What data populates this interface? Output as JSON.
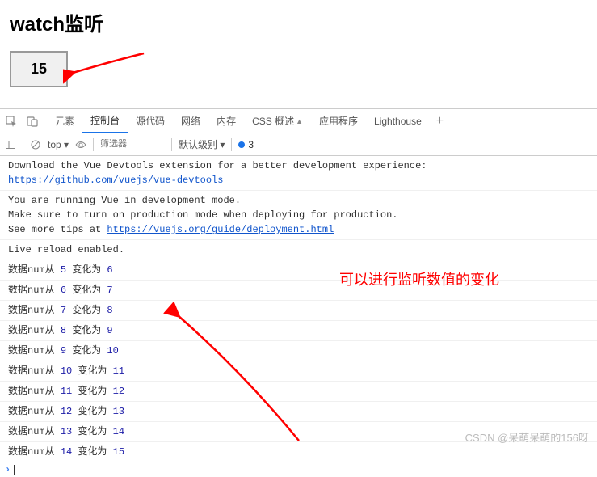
{
  "page": {
    "title": "watch监听",
    "counter_value": "15"
  },
  "devtools": {
    "tabs": [
      "元素",
      "控制台",
      "源代码",
      "网络",
      "内存",
      "CSS 概述",
      "应用程序",
      "Lighthouse"
    ],
    "active_tab": "控制台",
    "toolbar": {
      "context": "top",
      "filter_placeholder": "筛选器",
      "level": "默认级别",
      "badge_count": "3"
    }
  },
  "console_msgs": {
    "devtools_prompt": "Download the Vue Devtools extension for a better development experience:",
    "devtools_link": "https://github.com/vuejs/vue-devtools",
    "dev_mode_1": "You are running Vue in development mode.",
    "dev_mode_2": "Make sure to turn on production mode when deploying for production.",
    "dev_mode_3a": "See more tips at ",
    "dev_mode_3b": "https://vuejs.org/guide/deployment.html",
    "live_reload": "Live reload enabled."
  },
  "watch_logs": [
    {
      "prefix": "数据num从 ",
      "old": "5",
      "mid": " 变化为 ",
      "new": "6"
    },
    {
      "prefix": "数据num从 ",
      "old": "6",
      "mid": " 变化为 ",
      "new": "7"
    },
    {
      "prefix": "数据num从 ",
      "old": "7",
      "mid": " 变化为 ",
      "new": "8"
    },
    {
      "prefix": "数据num从 ",
      "old": "8",
      "mid": " 变化为 ",
      "new": "9"
    },
    {
      "prefix": "数据num从 ",
      "old": "9",
      "mid": " 变化为 ",
      "new": "10"
    },
    {
      "prefix": "数据num从 ",
      "old": "10",
      "mid": " 变化为 ",
      "new": "11"
    },
    {
      "prefix": "数据num从 ",
      "old": "11",
      "mid": " 变化为 ",
      "new": "12"
    },
    {
      "prefix": "数据num从 ",
      "old": "12",
      "mid": " 变化为 ",
      "new": "13"
    },
    {
      "prefix": "数据num从 ",
      "old": "13",
      "mid": " 变化为 ",
      "new": "14"
    },
    {
      "prefix": "数据num从 ",
      "old": "14",
      "mid": " 变化为 ",
      "new": "15"
    }
  ],
  "annotation": {
    "text": "可以进行监听数值的变化"
  },
  "watermark": "CSDN @呆萌呆萌的156呀"
}
